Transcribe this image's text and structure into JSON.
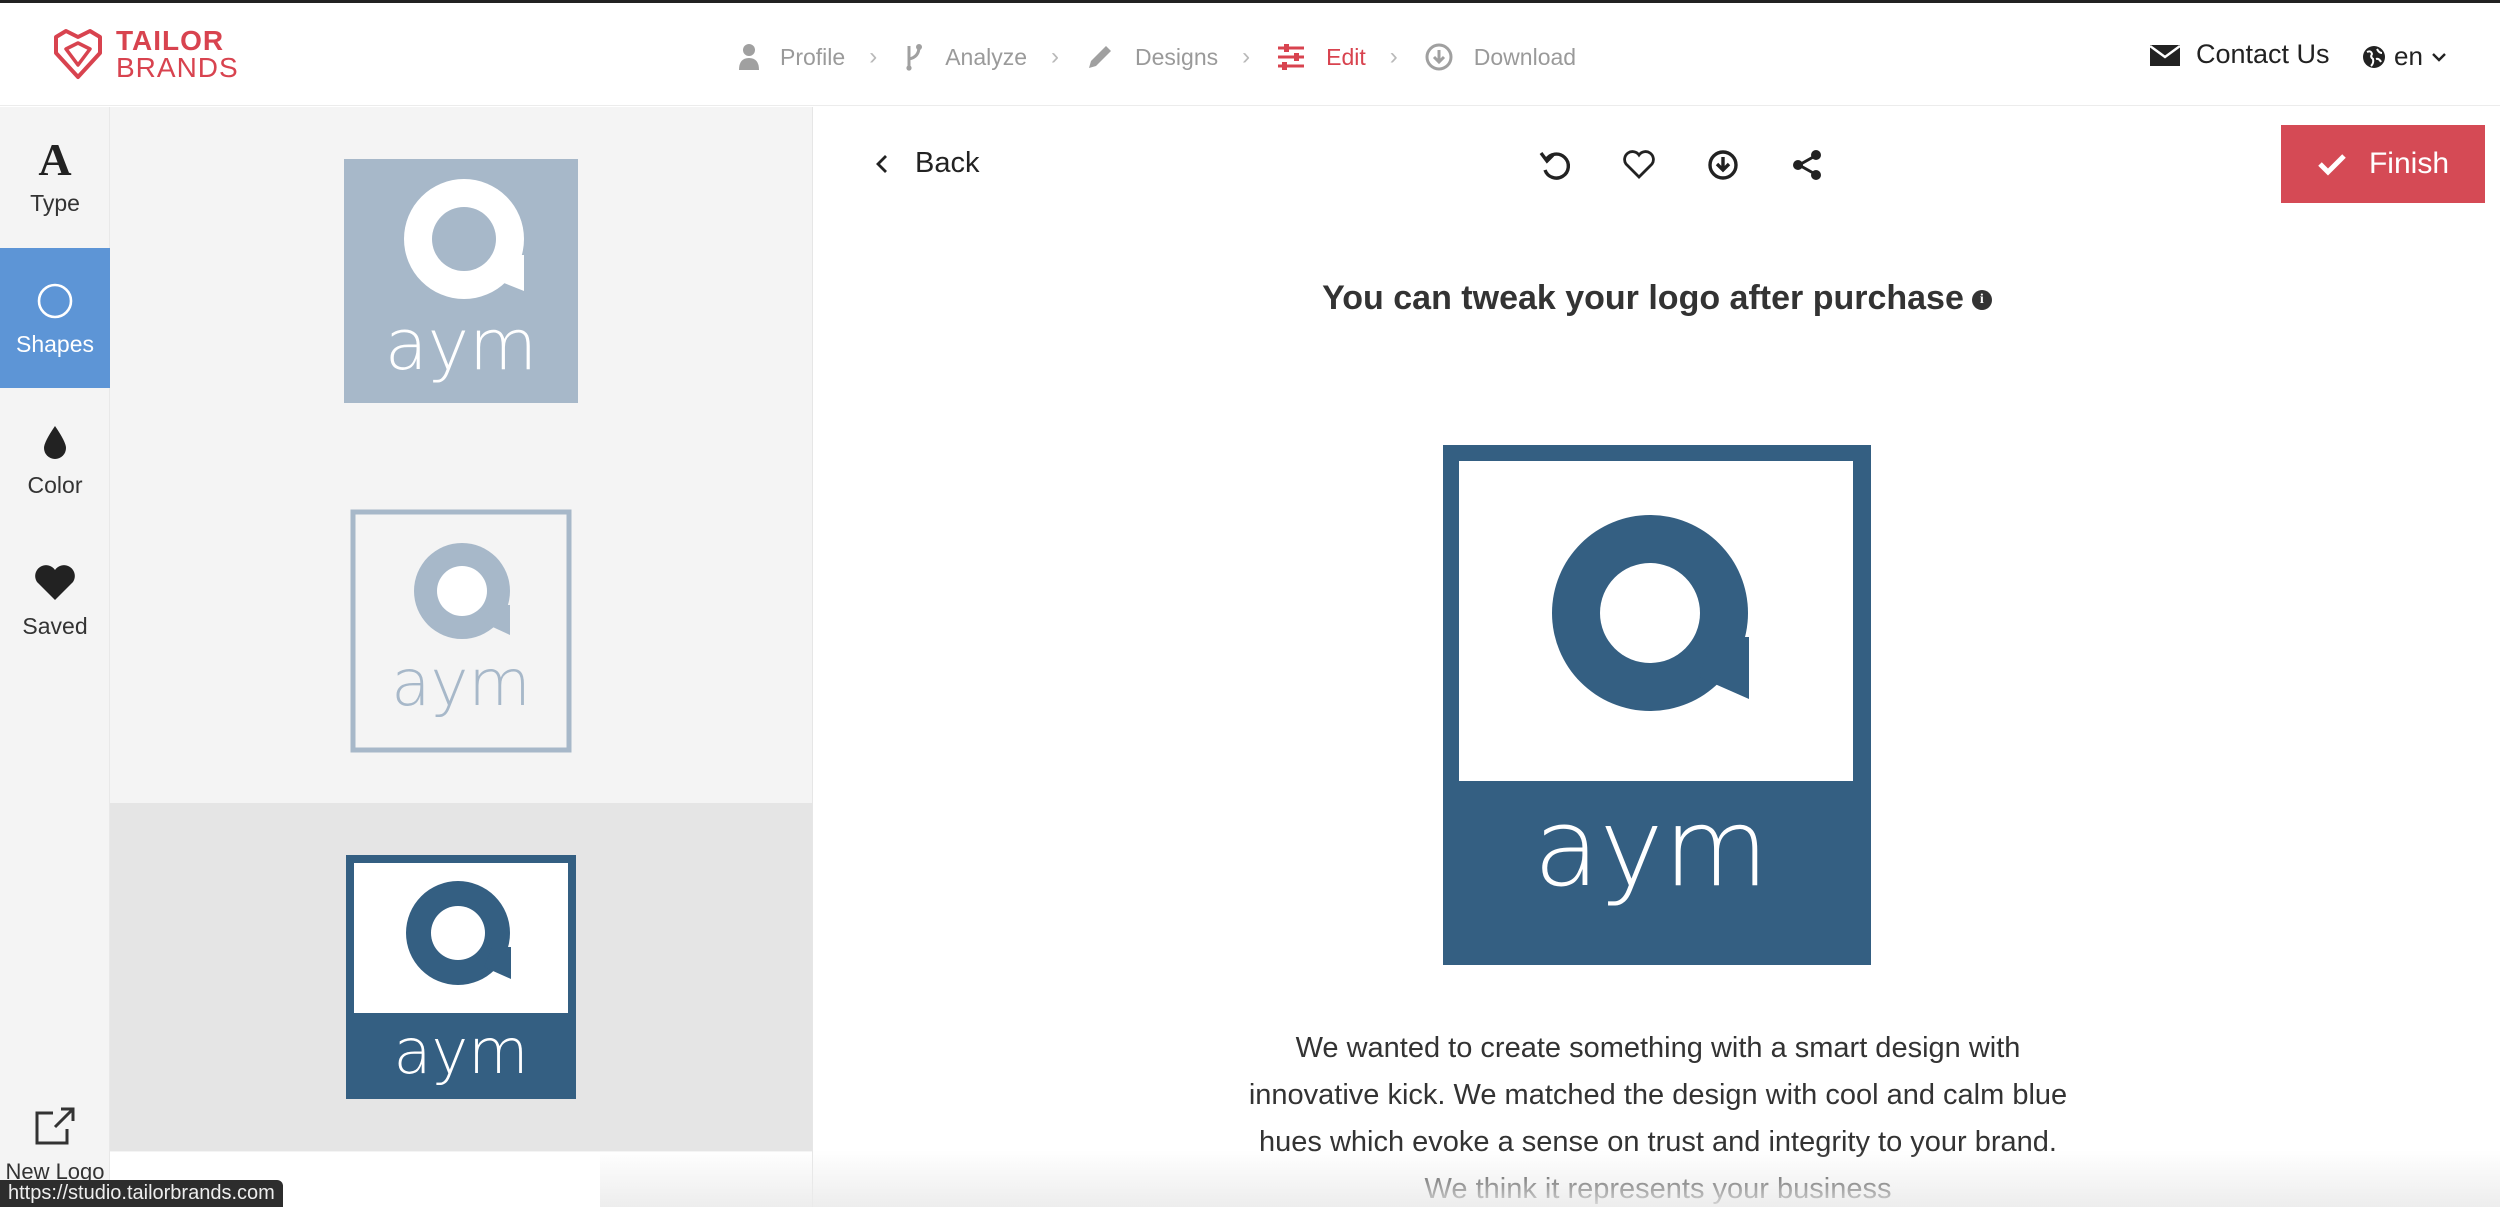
{
  "brand": {
    "line1": "TAILOR",
    "line2": "BRANDS",
    "color": "#d8434f"
  },
  "steps": [
    {
      "label": "Profile",
      "icon": "person-icon",
      "active": false
    },
    {
      "label": "Analyze",
      "icon": "branch-icon",
      "active": false
    },
    {
      "label": "Designs",
      "icon": "pencil-icon",
      "active": false
    },
    {
      "label": "Edit",
      "icon": "sliders-icon",
      "active": true
    },
    {
      "label": "Download",
      "icon": "download-circle-icon",
      "active": false
    }
  ],
  "header": {
    "contact_label": "Contact Us",
    "lang_label": "en"
  },
  "tools": [
    {
      "label": "Type",
      "icon": "type-icon",
      "active": false
    },
    {
      "label": "Shapes",
      "icon": "circle-icon",
      "active": true
    },
    {
      "label": "Color",
      "icon": "drop-icon",
      "active": false
    },
    {
      "label": "Saved",
      "icon": "heart-icon",
      "active": false
    }
  ],
  "new_logo_label": "New Logo",
  "logo_text": "aym",
  "colors": {
    "accent": "#d54a55",
    "selected_tool": "#5d95d6",
    "logo_blue": "#345f82",
    "logo_light": "#a7b8c9"
  },
  "editor": {
    "back_label": "Back",
    "finish_label": "Finish",
    "headline": "You can tweak your logo after purchase",
    "description": "We wanted to create something with a smart design with innovative kick. We matched the design with cool and calm blue hues which evoke a sense on trust and integrity to your brand. We think it represents your business"
  },
  "status_url": "https://studio.tailorbrands.com"
}
